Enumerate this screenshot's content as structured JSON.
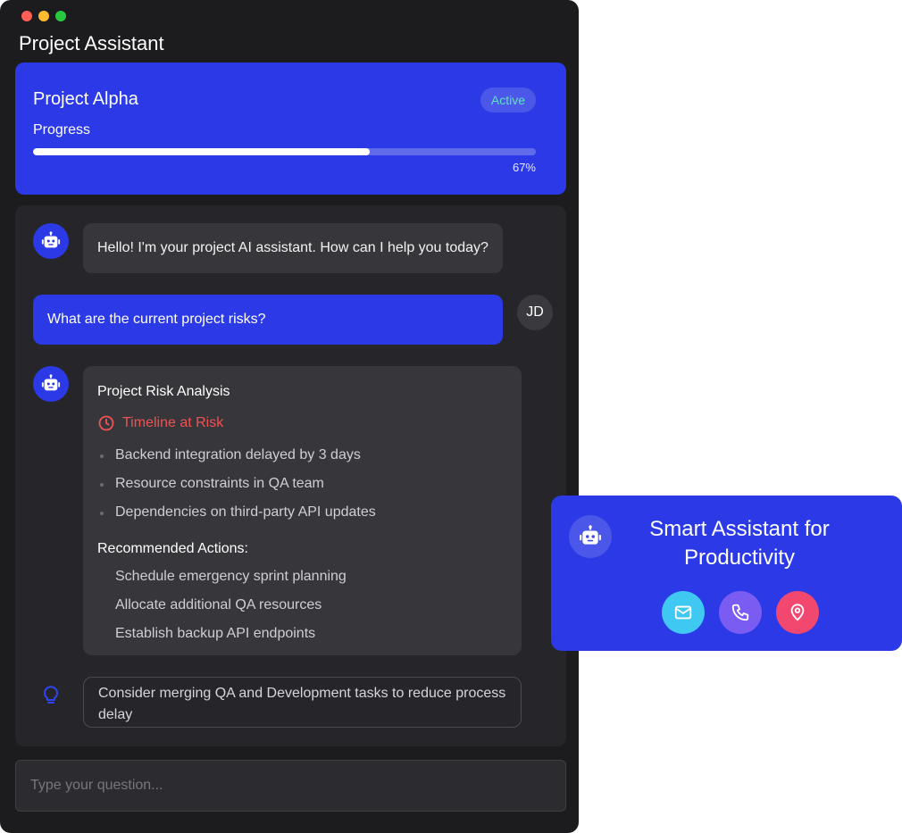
{
  "app": {
    "title": "Project Assistant"
  },
  "project": {
    "name": "Project Alpha",
    "status": "Active",
    "progress_label": "Progress",
    "progress_percent": 67,
    "progress_text": "67%"
  },
  "chat": {
    "messages": [
      {
        "sender": "bot",
        "text": "Hello! I'm your project AI assistant. How can I help you today?"
      },
      {
        "sender": "user",
        "avatar_initials": "JD",
        "text": "What are the current project risks?"
      }
    ],
    "analysis": {
      "title": "Project Risk Analysis",
      "risk_heading": "Timeline at Risk",
      "risks": [
        "Backend integration delayed by 3 days",
        "Resource constraints in QA team",
        "Dependencies on third-party API updates"
      ],
      "actions_heading": "Recommended Actions:",
      "actions": [
        "Schedule emergency sprint planning",
        "Allocate additional QA resources",
        "Establish backup API endpoints"
      ]
    },
    "tip": "Consider merging QA and Development tasks to reduce process delay"
  },
  "input": {
    "placeholder": "Type your question..."
  },
  "promo": {
    "title": "Smart Assistant for Productivity",
    "actions": [
      {
        "icon": "mail-icon",
        "color": "#3fc8f2"
      },
      {
        "icon": "phone-icon",
        "color": "#7b5cf2"
      },
      {
        "icon": "location-icon",
        "color": "#f2476f"
      }
    ]
  },
  "colors": {
    "accent": "#2b3ae6",
    "window_bg": "#1c1c1e",
    "status_green": "#5ee3c2",
    "risk_red": "#f05252"
  }
}
